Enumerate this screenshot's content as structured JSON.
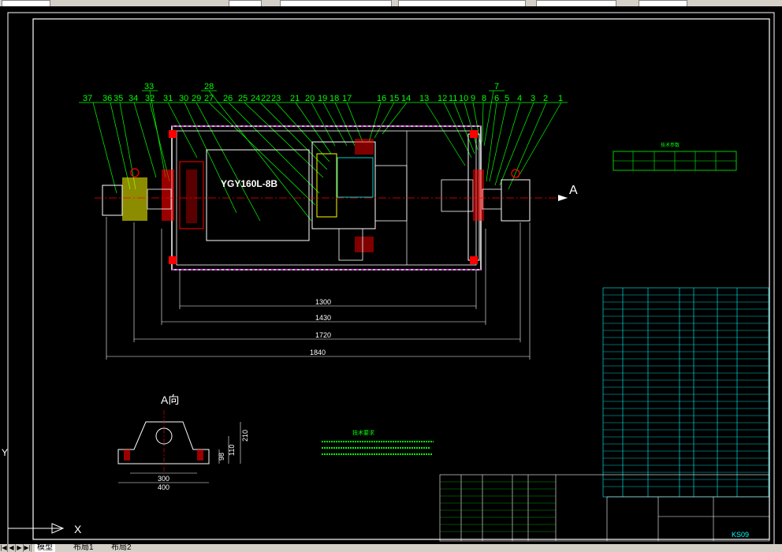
{
  "tabs": {
    "model": "模型",
    "layout1": "布局1",
    "layout2": "布局2"
  },
  "drawing": {
    "motor_label": "YGY160L-8B",
    "view_a_label": "A",
    "view_a_title": "A向",
    "dims": {
      "d1300": "1300",
      "d1430": "1430",
      "d1720": "1720",
      "d1840": "1840",
      "d300": "300",
      "d400": "400",
      "d210": "210",
      "d110": "110",
      "d98": "98"
    },
    "part_numbers_top": [
      "37",
      "36",
      "35",
      "34",
      "33",
      "32",
      "31",
      "30",
      "29",
      "28",
      "27",
      "26",
      "25",
      "24",
      "22",
      "23",
      "21",
      "20",
      "19",
      "18",
      "17",
      "16",
      "15",
      "14",
      "13",
      "12",
      "11",
      "10",
      "9",
      "8",
      "7",
      "6",
      "5",
      "4",
      "3",
      "2",
      "1"
    ],
    "tech_req_title": "技术要求",
    "param_table_title": "技术参数",
    "title_block_id": "KS09"
  },
  "colors": {
    "line": "#ffffff",
    "green": "#00ff00",
    "cyan": "#00ffff",
    "red": "#ff0000",
    "yellow": "#ffff00",
    "magenta": "#ff00ff"
  },
  "ucs": {
    "x": "X",
    "y": "Y"
  }
}
